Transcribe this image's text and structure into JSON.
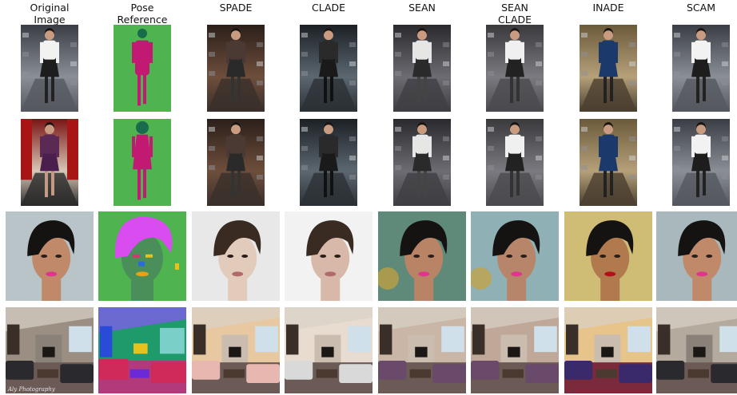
{
  "columns": [
    {
      "label": "Original\nImage"
    },
    {
      "label": "Pose\nReference"
    },
    {
      "label": "SPADE"
    },
    {
      "label": "CLADE"
    },
    {
      "label": "SEAN"
    },
    {
      "label": "SEAN\nCLADE"
    },
    {
      "label": "INADE"
    },
    {
      "label": "SCAM"
    }
  ],
  "rows": [
    {
      "name": "fashion-runway-1"
    },
    {
      "name": "fashion-runway-2"
    },
    {
      "name": "face-portrait"
    },
    {
      "name": "living-room"
    }
  ],
  "watermark": "Aly Photography",
  "colors": {
    "seg_background": "#4fb34f",
    "seg_person": "#c21a73",
    "seg_head": "#1a6b4b",
    "seg_hair": "#d84cf0",
    "face_skin": "#4a8f5a"
  }
}
